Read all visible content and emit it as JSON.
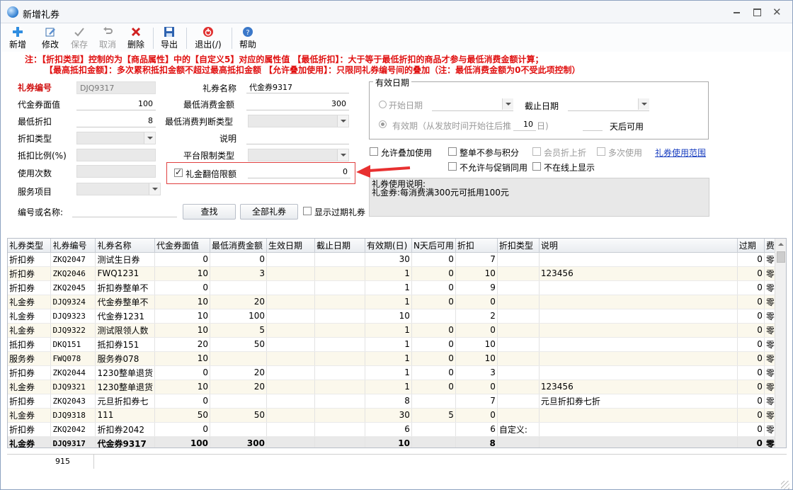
{
  "window": {
    "title": "新增礼券"
  },
  "toolbar": {
    "new": "新增",
    "edit": "修改",
    "save": "保存",
    "cancel": "取消",
    "delete": "删除",
    "export": "导出",
    "exit": "退出(/)",
    "help": "帮助"
  },
  "notes": {
    "line1": "注：【折扣类型】控制的为【商品属性】中的【自定义5】对应的属性值 【最低折扣】：大于等于最低折扣的商品才参与最低消费金额计算；",
    "line2": "【最高抵扣金额】：多次累积抵扣金额不超过最高抵扣金额 【允许叠加使用】：只限同礼券编号间的叠加（注：最低消费金额为0不受此项控制）"
  },
  "form": {
    "coupon_no_label": "礼券编号",
    "coupon_no": "DJQ9317",
    "face_value_label": "代金券面值",
    "face_value": "100",
    "min_discount_label": "最低折扣",
    "min_discount": "8",
    "discount_type_label": "折扣类型",
    "deduct_ratio_label": "抵扣比例(%)",
    "use_count_label": "使用次数",
    "service_label": "服务项目",
    "coupon_name_label": "礼券名称",
    "coupon_name": "代金券9317",
    "min_spend_label": "最低消费金额",
    "min_spend": "300",
    "min_spend_type_label": "最低消费判断类型",
    "desc_label": "说明",
    "platform_label": "平台限制类型",
    "double_limit_label": "礼金翻倍限额",
    "double_limit": "0",
    "search_label": "编号或名称:",
    "search_btn": "查找",
    "all_btn": "全部礼券",
    "show_expired": "显示过期礼券"
  },
  "validity": {
    "title": "有效日期",
    "start_date": "开始日期",
    "end_date": "截止日期",
    "valid_period": "有效期（从发放时间开始往后推",
    "days_value": "10",
    "days_unit": "日)",
    "after_days": "天后可用"
  },
  "options": {
    "allow_stack": "允许叠加使用",
    "no_points": "整单不参与积分",
    "member_discount": "会员折上折",
    "multi_use": "多次使用",
    "scope_link": "礼券使用范围",
    "no_promo": "不允许与促销同用",
    "not_online": "不在线上显示"
  },
  "memo": {
    "line1": "礼券使用说明:",
    "line2": "礼金券:每消费满300元可抵用100元"
  },
  "table": {
    "headers": [
      "礼券类型",
      "礼券编号",
      "礼券名称",
      "代金券面值",
      "最低消费金额",
      "生效日期",
      "截止日期",
      "有效期(日)",
      "N天后可用",
      "折扣",
      "折扣类型",
      "说明",
      "过期",
      "费用"
    ],
    "rows": [
      [
        "折扣券",
        "ZKQ2047",
        "测试生日券",
        "0",
        "0",
        "",
        "",
        "30",
        "0",
        "7",
        "",
        "",
        "0",
        "零售"
      ],
      [
        "折扣券",
        "ZKQ2046",
        "FWQ1231",
        "10",
        "3",
        "",
        "",
        "1",
        "0",
        "10",
        "",
        "123456",
        "0",
        "零售"
      ],
      [
        "折扣券",
        "ZKQ2045",
        "折扣券整单不",
        "0",
        "",
        "",
        "",
        "1",
        "0",
        "9",
        "",
        "",
        "0",
        "零售"
      ],
      [
        "礼金券",
        "DJQ9324",
        "代金券整单不",
        "10",
        "20",
        "",
        "",
        "1",
        "0",
        "0",
        "",
        "",
        "0",
        "零售"
      ],
      [
        "礼金券",
        "DJQ9323",
        "代金券1231",
        "10",
        "100",
        "",
        "",
        "10",
        "",
        "2",
        "",
        "",
        "0",
        "零售"
      ],
      [
        "礼金券",
        "DJQ9322",
        "测试限领人数",
        "10",
        "5",
        "",
        "",
        "1",
        "0",
        "0",
        "",
        "",
        "0",
        "零售"
      ],
      [
        "抵扣券",
        "DKQ151",
        "抵扣券151",
        "20",
        "50",
        "",
        "",
        "1",
        "0",
        "10",
        "",
        "",
        "0",
        "零售"
      ],
      [
        "服务券",
        "FWQ078",
        "服务券078",
        "10",
        "",
        "",
        "",
        "1",
        "0",
        "10",
        "",
        "",
        "0",
        "零售"
      ],
      [
        "折扣券",
        "ZKQ2044",
        "1230整单退货",
        "0",
        "20",
        "",
        "",
        "1",
        "0",
        "3",
        "",
        "",
        "0",
        "零售"
      ],
      [
        "礼金券",
        "DJQ9321",
        "1230整单退货",
        "10",
        "20",
        "",
        "",
        "1",
        "0",
        "0",
        "",
        "123456",
        "0",
        "零售"
      ],
      [
        "折扣券",
        "ZKQ2043",
        "元旦折扣券七",
        "0",
        "",
        "",
        "",
        "8",
        "",
        "7",
        "",
        "元旦折扣券七折",
        "0",
        "零售"
      ],
      [
        "礼金券",
        "DJQ9318",
        "111",
        "50",
        "50",
        "",
        "",
        "30",
        "5",
        "0",
        "",
        "",
        "0",
        "零售"
      ],
      [
        "折扣券",
        "ZKQ2042",
        "折扣券2042",
        "0",
        "",
        "",
        "",
        "6",
        "",
        "6",
        "自定义:",
        "",
        "0",
        "零售"
      ],
      [
        "礼金券",
        "DJQ9317",
        "代金券9317",
        "100",
        "300",
        "",
        "",
        "10",
        "",
        "8",
        "",
        "",
        "0",
        "零售"
      ]
    ]
  },
  "footer": {
    "count": "915"
  }
}
